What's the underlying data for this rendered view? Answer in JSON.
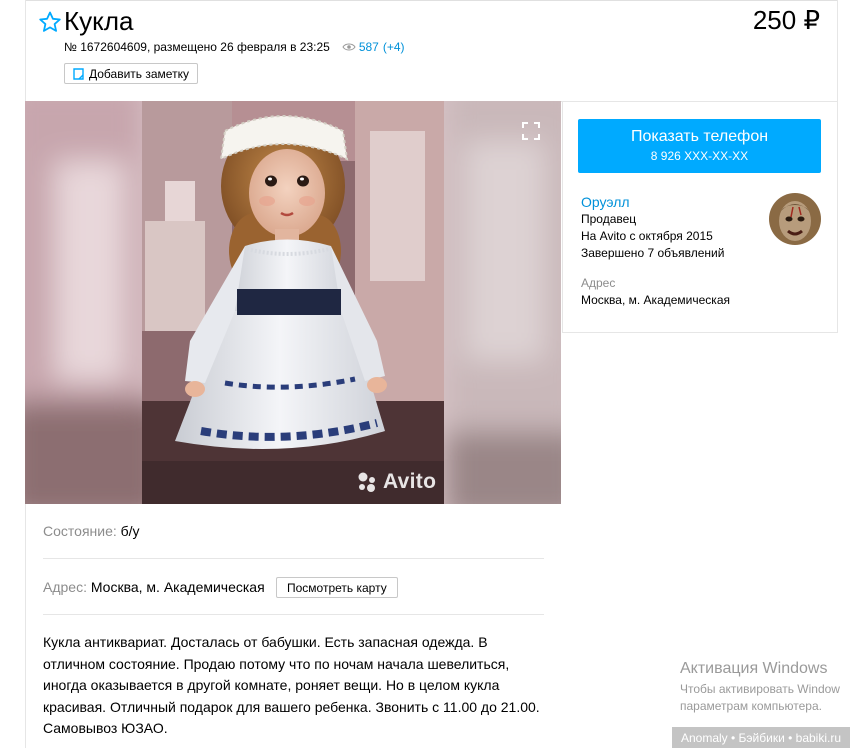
{
  "listing": {
    "title": "Кукла",
    "price": "250 ₽",
    "meta": "№ 1672604609, размещено 26 февраля в 23:25",
    "views": "587",
    "views_today": "(+4)",
    "add_note": "Добавить заметку"
  },
  "contact": {
    "phone_button_label": "Показать телефон",
    "phone_masked": "8 926 XXX-XX-XX"
  },
  "seller": {
    "name": "Оруэлл",
    "role": "Продавец",
    "since": "На Avito с октября 2015",
    "completed": "Завершено 7 объявлений",
    "address_label": "Адрес",
    "address": "Москва, м. Академическая"
  },
  "gallery": {
    "watermark": "Avito"
  },
  "params": {
    "condition_label": "Состояние:",
    "condition_value": "б/у",
    "address_label": "Адрес:",
    "address_value": "Москва, м. Академическая",
    "map_button": "Посмотреть карту"
  },
  "description": "Кукла антиквариат. Досталась от бабушки. Есть запасная одежда. В отличном состояние. Продаю потому что по ночам начала шевелиться, иногда оказывается в другой комнате, роняет вещи. Но в целом кукла красивая. Отличный подарок для вашего ребенка. Звонить с 11.00 до 21.00. Самовывоз ЮЗАО.",
  "windows_activation": {
    "title": "Активация Windows",
    "line1": "Чтобы активировать Window",
    "line2": "параметрам компьютера."
  },
  "site_tag": "Anomaly • Бэйбики • babiki.ru",
  "colors": {
    "link": "#0091d9",
    "phone_button": "#00aaff",
    "muted": "#8c8c8c"
  }
}
